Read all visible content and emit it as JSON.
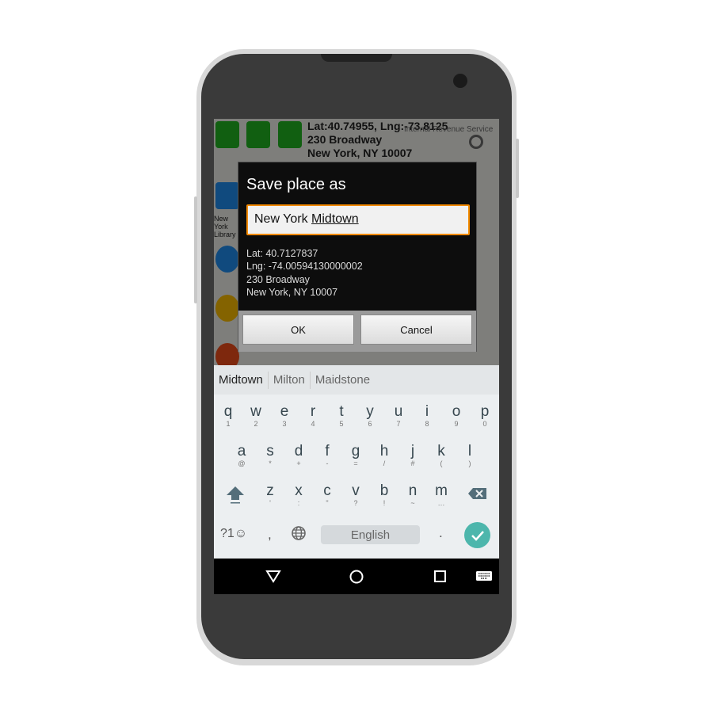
{
  "map_header": {
    "line1": "Lat:40.74955, Lng:-73.8125",
    "line2": "230 Broadway",
    "line3": "New York, NY 10007",
    "poi": "Internal Revenue Service",
    "side_label": "New York Library"
  },
  "dialog": {
    "title": "Save place as",
    "input_value_prefix": "New York ",
    "input_value_composing": "Midtown",
    "lat": "Lat: 40.7127837",
    "lng": "Lng: -74.00594130000002",
    "address1": "230 Broadway",
    "address2": "New York, NY 10007",
    "ok_label": "OK",
    "cancel_label": "Cancel",
    "accent": "#f28a00"
  },
  "keyboard": {
    "suggestions": [
      "Midtown",
      "Milton",
      "Maidstone"
    ],
    "row1": [
      {
        "k": "q",
        "s": "1"
      },
      {
        "k": "w",
        "s": "2"
      },
      {
        "k": "e",
        "s": "3"
      },
      {
        "k": "r",
        "s": "4"
      },
      {
        "k": "t",
        "s": "5"
      },
      {
        "k": "y",
        "s": "6"
      },
      {
        "k": "u",
        "s": "7"
      },
      {
        "k": "i",
        "s": "8"
      },
      {
        "k": "o",
        "s": "9"
      },
      {
        "k": "p",
        "s": "0"
      }
    ],
    "row2": [
      {
        "k": "a",
        "s": "@"
      },
      {
        "k": "s",
        "s": "*"
      },
      {
        "k": "d",
        "s": "+"
      },
      {
        "k": "f",
        "s": "-"
      },
      {
        "k": "g",
        "s": "="
      },
      {
        "k": "h",
        "s": "/"
      },
      {
        "k": "j",
        "s": "#"
      },
      {
        "k": "k",
        "s": "("
      },
      {
        "k": "l",
        "s": ")"
      }
    ],
    "row3": [
      {
        "k": "z",
        "s": "'"
      },
      {
        "k": "x",
        "s": ":"
      },
      {
        "k": "c",
        "s": "\""
      },
      {
        "k": "v",
        "s": "?"
      },
      {
        "k": "b",
        "s": "!"
      },
      {
        "k": "n",
        "s": "~"
      },
      {
        "k": "m",
        "s": "…"
      }
    ],
    "symbols_label": "?1☺",
    "comma": ",",
    "space_label": "English",
    "period": ".",
    "enter_color": "#4db6ac"
  }
}
